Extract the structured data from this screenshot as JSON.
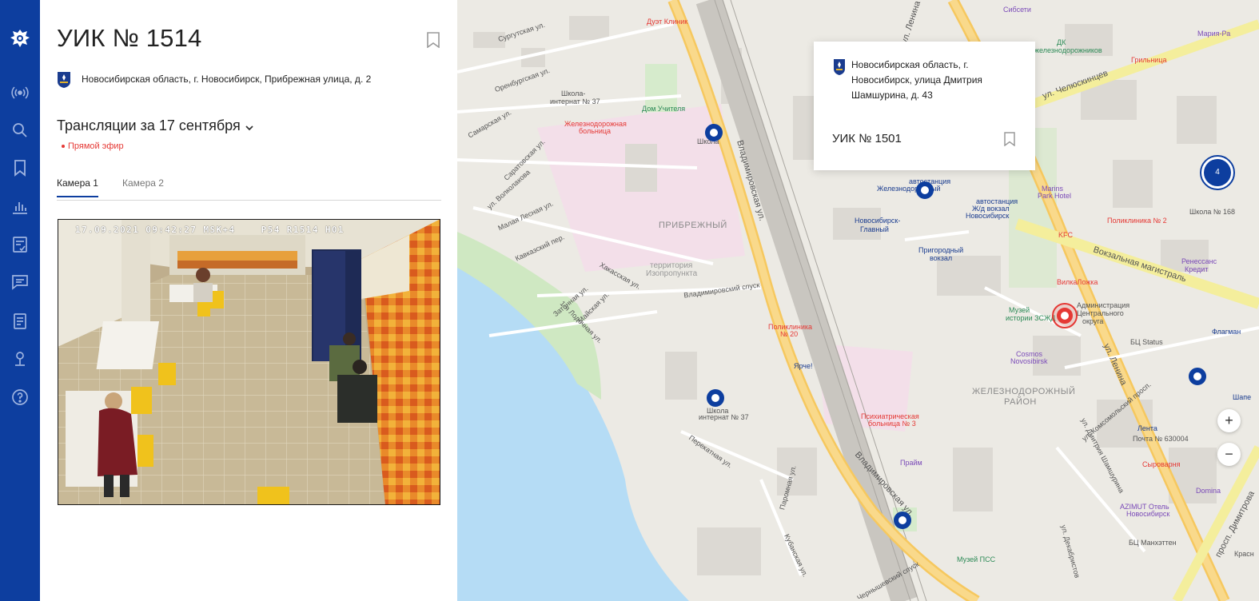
{
  "sidebar": {
    "items": [
      {
        "name": "broadcast-icon"
      },
      {
        "name": "search-icon"
      },
      {
        "name": "bookmark-icon"
      },
      {
        "name": "statistics-icon"
      },
      {
        "name": "checklist-icon"
      },
      {
        "name": "messages-icon"
      },
      {
        "name": "document-icon"
      },
      {
        "name": "person-icon"
      },
      {
        "name": "help-icon"
      }
    ],
    "accent": "#0d3e9f"
  },
  "panel": {
    "title": "УИК № 1514",
    "address": "Новосибирская область, г. Новосибирск, Прибрежная улица, д. 2",
    "broadcast_title": "Трансляции за 17 сентября",
    "live_label": "Прямой эфир",
    "tabs": [
      "Камера 1",
      "Камера 2"
    ],
    "active_tab": "Камера 1",
    "video_overlay": "17.09.2021 09:42:27 MSK+4    P54 R1514 H01"
  },
  "map": {
    "popup": {
      "address": "Новосибирская область, г. Новосибирск, улица Дмитрия Шамшурина, д. 43",
      "title": "УИК № 1501"
    },
    "cluster_count": "4",
    "zoom_in": "+",
    "zoom_out": "−",
    "labels": {
      "l_duet": "Дуэт Клиник",
      "l_lenina1": "ул. Ленина",
      "l_sibseti": "Сибсети",
      "l_dk": "ДК",
      "l_zhd": "железнодорожников",
      "l_griln": "Грильница",
      "l_mariya": "Мария-Ра",
      "l_chel": "ул. Челюскинцев",
      "l_school37": "Школа-",
      "l_school37b": "интернат № 37",
      "l_dom": "Дом Учителя",
      "l_zhel": "Железнодорожная",
      "l_bol": "больница",
      "l_shkola": "Школа",
      "l_vladim1": "Владимировская ул.",
      "l_pribr": "ПРИБРЕЖНЫЙ",
      "l_terr": "территория",
      "l_izo": "Изопропункта",
      "l_vlspusk": "Владимировский спуск",
      "l_avto": "автостанция",
      "l_zhdv": "Железнодорожный",
      "l_avto2": "автостанция",
      "l_zhdv2": "Ж/д вокзал",
      "l_nsk": "Новосибирск",
      "l_nskgl": "Новосибирск-",
      "l_glav": "Главный",
      "l_prig": "Пригородный",
      "l_vokzal": "вокзал",
      "l_marins": "Marins",
      "l_park": "Park Hotel",
      "l_polik2": "Поликлиника № 2",
      "l_kfc": "KFC",
      "l_shk168": "Школа № 168",
      "l_vokmag": "Вокзальная магистраль",
      "l_renes": "Ренессанс",
      "l_kredit": "Кредит",
      "l_vilka": "ВилкаЛожка",
      "l_muzey": "Музей",
      "l_istor": "истории ЗСЖД",
      "l_admin": "Администрация",
      "l_centr": "Центрального",
      "l_okrug": "округа",
      "l_polik20": "Поликлиника",
      "l_n20": "№ 20",
      "l_yarche": "Ярче!",
      "l_cosmos": "Cosmos",
      "l_nsk2": "Novosibirsk",
      "l_zhdr": "ЖЕЛЕЗНОДОРОЖНЫЙ",
      "l_rayon": "РАЙОН",
      "l_bc": "БЦ Status",
      "l_flag": "Флагман",
      "l_lenina2": "ул. Ленина",
      "l_shk37b": "Школа",
      "l_int37": "интернат № 37",
      "l_psih": "Психиатрическая",
      "l_bol3": "больница № 3",
      "l_lenta": "Лента",
      "l_pochta": "Почта № 630004",
      "l_syrov": "Сыроварня",
      "l_prime": "Прайм",
      "l_vladim2": "Владимировская ул.",
      "l_domina": "Domina",
      "l_azimut": "AZIMUT Отель",
      "l_azimut2": "Новосибирск",
      "l_bcman": "БЦ Манхэттен",
      "l_muzpss": "Музей ПСС",
      "l_dimitrova": "просп. Димитрова",
      "l_shape": "Шапе",
      "l_komsom": "ул. Комсомольский просп.",
      "l_shamsh": "ул. Дмитрия Шамшурина",
      "l_surgut": "Сургутская ул.",
      "l_orenb": "Оренбургская ул.",
      "l_samar": "Самарская ул.",
      "l_sarat": "Саратовская ул.",
      "l_volkol": "ул. Волколакова",
      "l_malaya": "Малая Лесная ул.",
      "l_kavkaz": "Кавказский пер.",
      "l_hakas": "Хакасская ул.",
      "l_zaton": "Затонная ул.",
      "l_lodoch": "1-я Лодочная ул.",
      "l_maysk": "Майская ул.",
      "l_perek": "Перекатная ул.",
      "l_parom": "Паромная ул.",
      "l_kubansk": "Кубанская ул.",
      "l_chernysh": "Чернышевский спуск",
      "l_dekab": "ул. Декабристов",
      "l_krasn": "Красн"
    }
  }
}
